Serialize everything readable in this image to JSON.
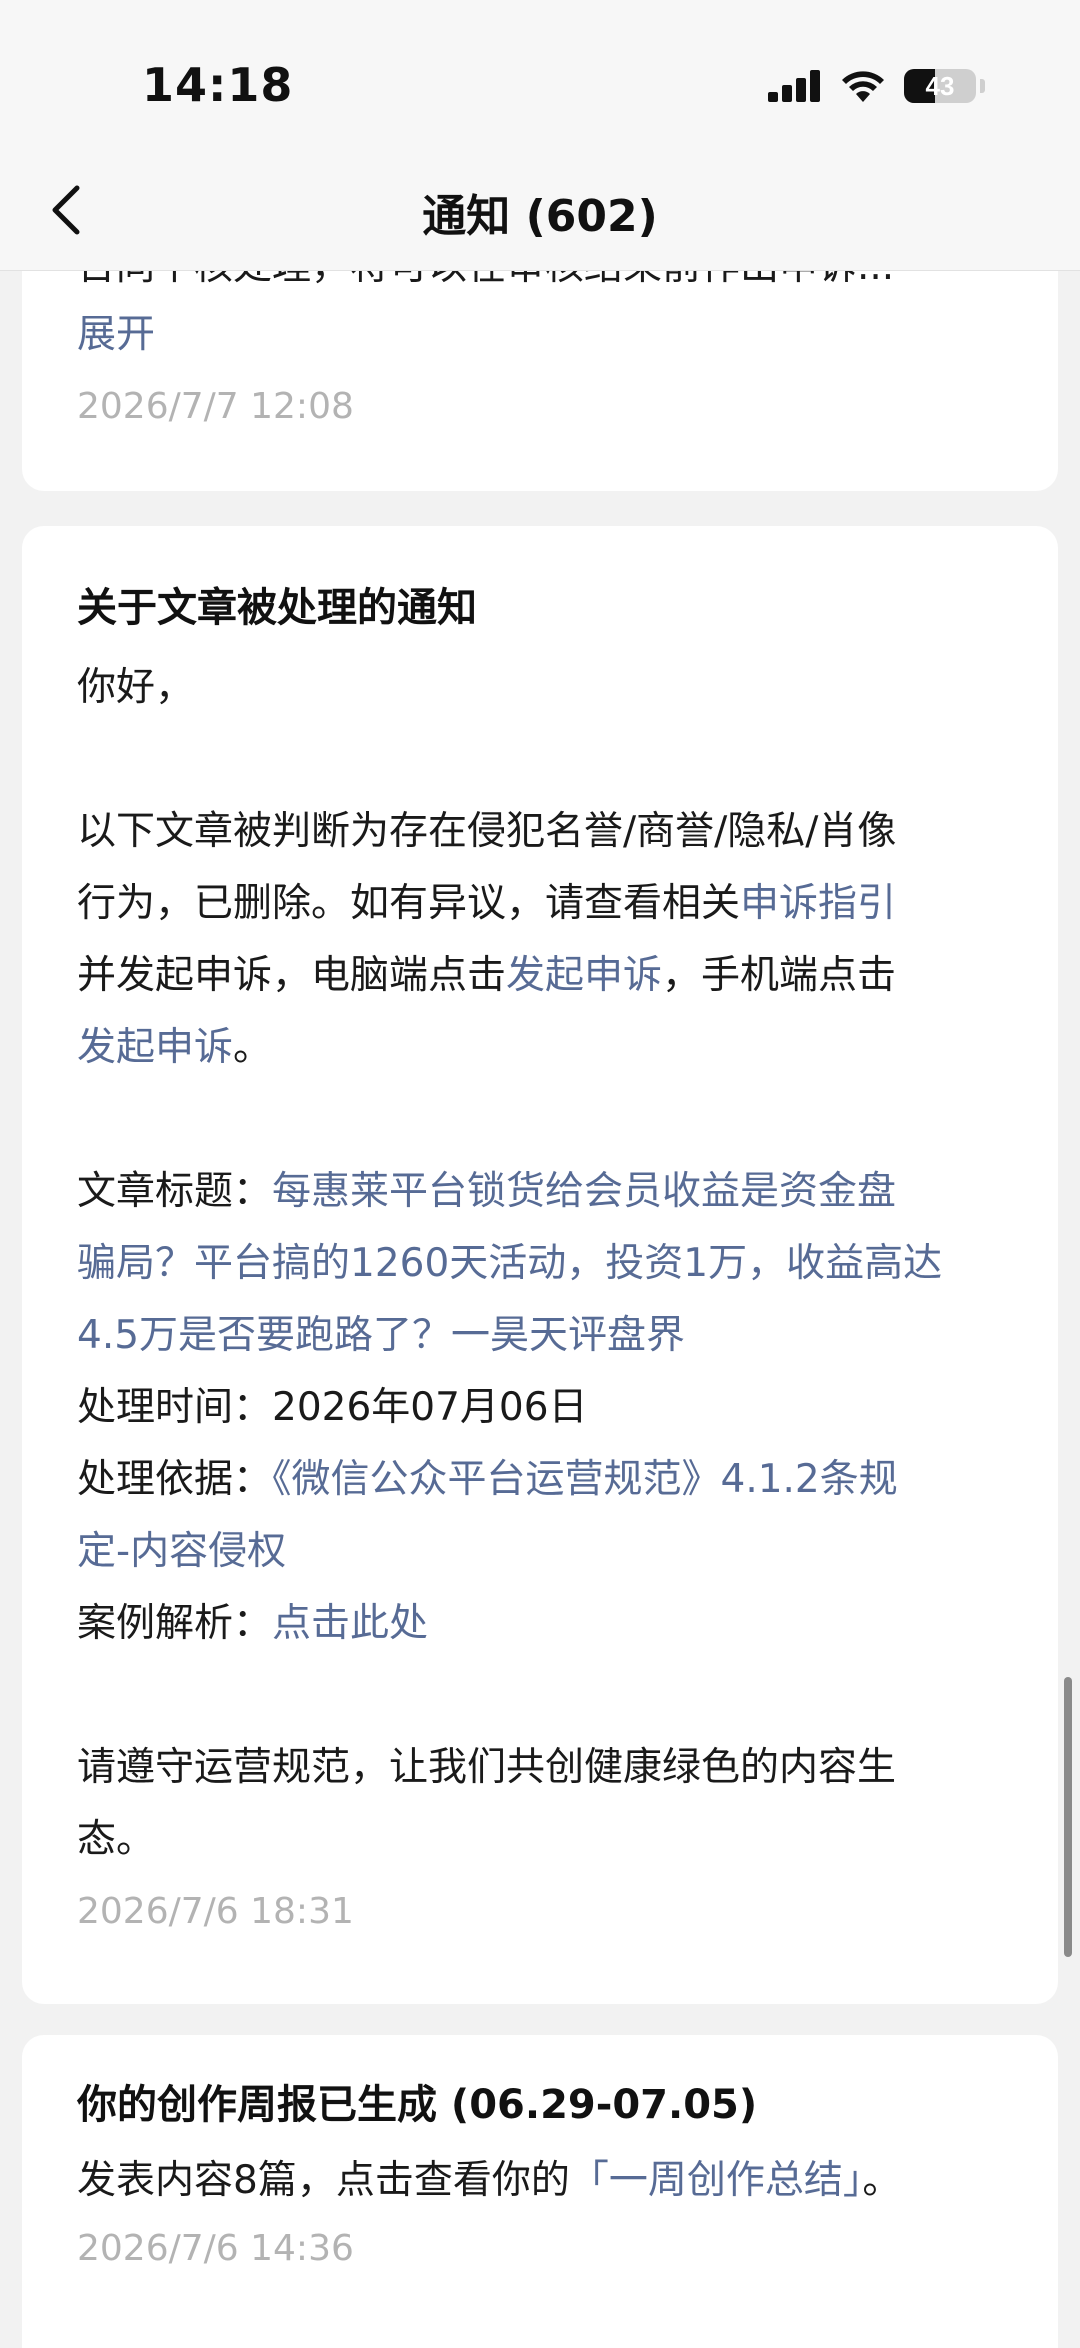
{
  "status_bar": {
    "time": "14:18",
    "battery_level": "43",
    "battery_fraction": 0.43,
    "icons": [
      "cellular-signal-icon",
      "wifi-icon",
      "battery-icon"
    ]
  },
  "nav": {
    "title": "通知 (602)",
    "back_icon": "chevron-left-icon"
  },
  "notifications": [
    {
      "clipped_text": "台同平核处理，将可以在审核结束前作出申诉...",
      "expand_label": "展开",
      "timestamp": "2026/7/7  12:08"
    },
    {
      "title": "关于文章被处理的通知",
      "greeting": "你好，",
      "para1": {
        "t1": "以下文章被判断为存在侵犯名誉/商誉/隐私/肖像",
        "t2": "行为，已删除。如有异议，请查看相关",
        "link1": "申诉指引",
        "t3": "并发起申诉，电脑端点击",
        "link2": "发起申诉",
        "t4": "，手机端点击",
        "link3": "发起申诉",
        "t5": "。"
      },
      "article_label": "文章标题：",
      "article_title_l1": "每惠莱平台锁货给会员收益是资金盘",
      "article_title_l2": "骗局？平台搞的1260天活动，投资1万，收益高达",
      "article_title_l3": "4.5万是否要跑路了？一昊天评盘界",
      "time_label": "处理时间：",
      "time_value": "2026年07月06日",
      "basis_label": "处理依据：",
      "basis_l1": "《微信公众平台运营规范》4.1.2条规",
      "basis_l2": "定-内容侵权",
      "case_label": "案例解析：",
      "case_link": "点击此处",
      "closing_l1": "请遵守运营规范，让我们共创健康绿色的内容生",
      "closing_l2": "态。",
      "timestamp": "2026/7/6  18:31"
    },
    {
      "title": "你的创作周报已生成 (06.29-07.05)",
      "text": "发表内容8篇，点击查看你的",
      "link": "「一周创作总结」",
      "text_end": "。",
      "timestamp": "2026/7/6  14:36"
    }
  ],
  "colors": {
    "link": "#576b95",
    "timestamp": "#b3b3b3",
    "background": "#f2f2f2",
    "card": "#ffffff"
  }
}
